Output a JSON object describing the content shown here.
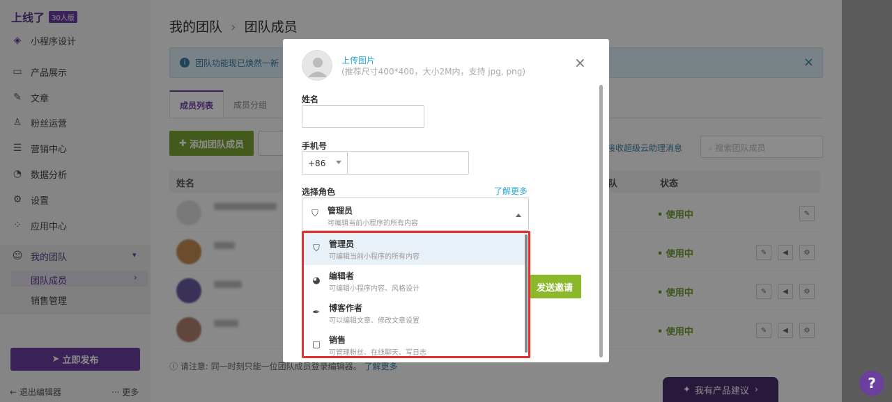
{
  "sidebar": {
    "logo": "上线了",
    "badge": "30人版",
    "items": [
      {
        "label": "小程序设计",
        "icon": "layers-icon"
      },
      {
        "label": "产品展示",
        "icon": "bag-icon"
      },
      {
        "label": "文章",
        "icon": "pen-icon"
      },
      {
        "label": "粉丝运营",
        "icon": "user-icon"
      },
      {
        "label": "营销中心",
        "icon": "list-icon"
      },
      {
        "label": "数据分析",
        "icon": "pie-icon"
      },
      {
        "label": "设置",
        "icon": "gear-icon"
      },
      {
        "label": "应用中心",
        "icon": "apps-icon"
      }
    ],
    "team": {
      "label": "我的团队",
      "sub": [
        "团队成员",
        "销售管理"
      ]
    },
    "publish": "立即发布",
    "exit": "退出编辑器",
    "more": "··· 更多"
  },
  "main": {
    "breadcrumb": [
      "我的团队",
      "团队成员"
    ],
    "info": "团队功能现已焕然一新",
    "tabs": [
      "成员列表",
      "成员分组"
    ],
    "add_button": "添加团队成员",
    "sub_link": "接收超级云助理消息",
    "search_placeholder": "搜索团队成员",
    "table_headers": {
      "name": "姓名",
      "team": "队",
      "status": "状态"
    },
    "rows": [
      {
        "status": "使用中"
      },
      {
        "status": "使用中"
      },
      {
        "status": "使用中"
      },
      {
        "status": "使用中"
      }
    ],
    "note": "请注意: 同一时刻只能一位团队成员登录编辑器。",
    "note_link": "了解更多",
    "feedback": "我有产品建议"
  },
  "modal": {
    "upload_label": "上传图片",
    "upload_hint": "(推荐尺寸400*400，大小2M内，支持 jpg, png)",
    "name_label": "姓名",
    "phone_label": "手机号",
    "country_code": "+86",
    "role_label": "选择角色",
    "learn_more": "了解更多",
    "selected_role": {
      "title": "管理员",
      "desc": "可编辑当前小程序的所有内容"
    },
    "send_button": "发送邀请",
    "roles": [
      {
        "title": "管理员",
        "desc": "可编辑当前小程序的所有内容",
        "icon": "shield-icon"
      },
      {
        "title": "编辑者",
        "desc": "可编辑小程序内容、风格设计",
        "icon": "palette-icon"
      },
      {
        "title": "博客作者",
        "desc": "可以编辑文章、修改文章设置",
        "icon": "quill-icon"
      },
      {
        "title": "销售",
        "desc": "可管理粉丝、在线聊天、写日志",
        "icon": "chat-icon"
      }
    ]
  },
  "colors": {
    "brand": "#6b3fa0",
    "green": "#7aa534",
    "link": "#29a9d6",
    "highlight": "#e03030"
  }
}
